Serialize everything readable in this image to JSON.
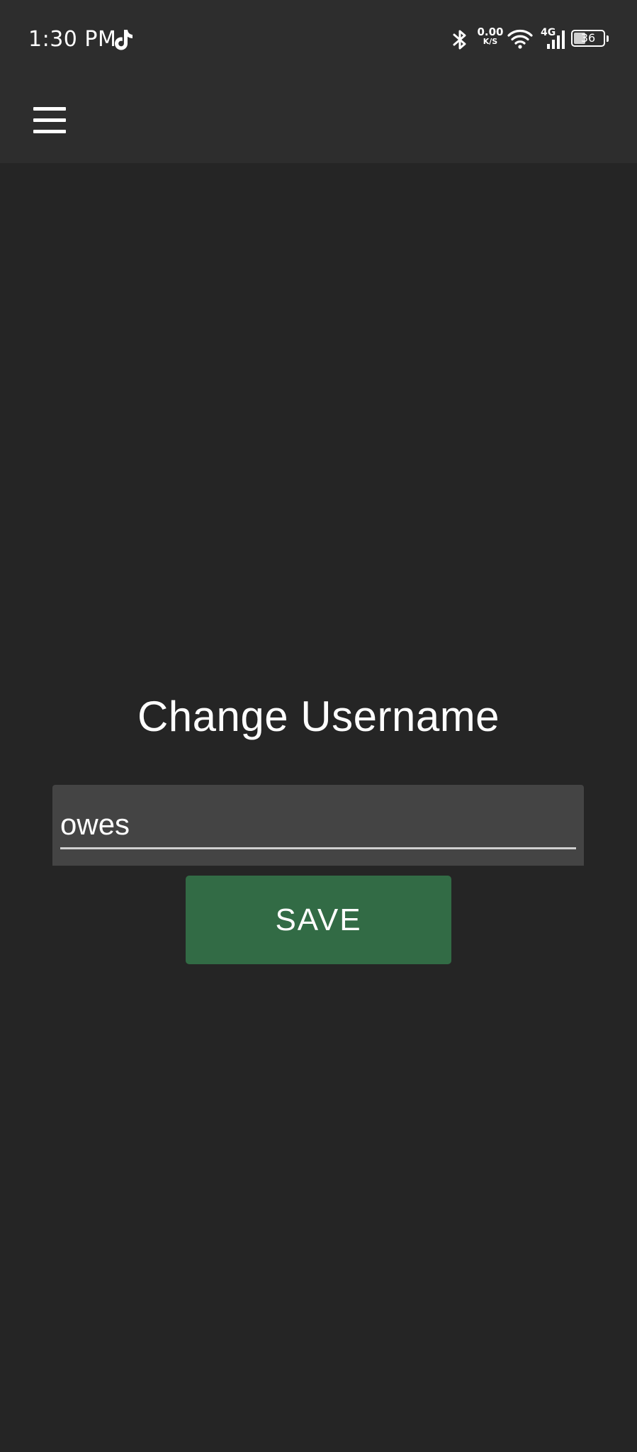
{
  "status_bar": {
    "time": "1:30 PM",
    "net_speed_value": "0.00",
    "net_speed_unit": "K/S",
    "network_type": "4G",
    "battery_level": "36",
    "icons": [
      "tiktok-icon",
      "bluetooth-icon",
      "wifi-icon",
      "signal-icon",
      "battery-icon"
    ]
  },
  "app_bar": {
    "menu_icon": "hamburger-menu-icon"
  },
  "main": {
    "title": "Change Username",
    "username_input": {
      "value": "owes"
    },
    "save_label": "SAVE"
  },
  "colors": {
    "background": "#252525",
    "app_bar": "#2d2d2d",
    "input_fill": "#444444",
    "save_button": "#326b45",
    "text": "#ffffff"
  }
}
